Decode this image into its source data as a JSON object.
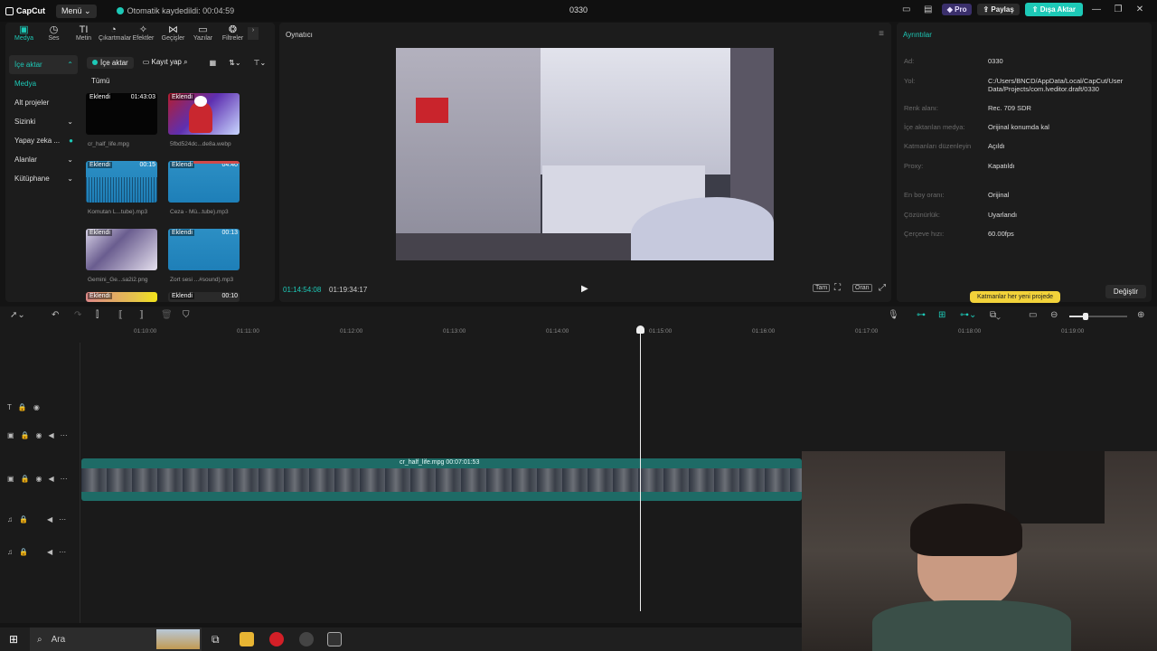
{
  "titlebar": {
    "app_name": "CapCut",
    "menu_label": "Menü",
    "autosave": "Otomatik kaydedildi: 00:04:59",
    "project_title": "0330",
    "pro_label": "Pro",
    "share_label": "Paylaş",
    "export_label": "Dışa Aktar"
  },
  "toolbar": {
    "tools": [
      {
        "label": "Medya",
        "icon": "media-icon"
      },
      {
        "label": "Ses",
        "icon": "audio-icon"
      },
      {
        "label": "Metin",
        "icon": "text-icon"
      },
      {
        "label": "Çıkartmalar",
        "icon": "sticker-icon"
      },
      {
        "label": "Efektler",
        "icon": "effects-icon"
      },
      {
        "label": "Geçişler",
        "icon": "transitions-icon"
      },
      {
        "label": "Yazılar",
        "icon": "captions-icon"
      },
      {
        "label": "Filtreler",
        "icon": "filters-icon"
      }
    ]
  },
  "sidebar": {
    "items": [
      {
        "label": "İçe aktar"
      },
      {
        "label": "Medya"
      },
      {
        "label": "Alt projeler"
      },
      {
        "label": "Sizinki"
      },
      {
        "label": "Yapay zeka ..."
      },
      {
        "label": "Alanlar"
      },
      {
        "label": "Kütüphane"
      }
    ]
  },
  "media": {
    "import_label": "İçe aktar",
    "record_label": "Kayıt yap",
    "all_label": "Tümü",
    "items": [
      {
        "tag": "Eklendi",
        "duration": "01:43:03",
        "name": "cr_half_life.mpg"
      },
      {
        "tag": "Eklendi",
        "duration": "",
        "name": "5fbd524dc...de8a.webp"
      },
      {
        "tag": "Eklendi",
        "duration": "00:15",
        "name": "Komutan L...tube).mp3"
      },
      {
        "tag": "Eklendi",
        "duration": "04:40",
        "name": "Ceza - Mü...tube).mp3"
      },
      {
        "tag": "Eklendi",
        "duration": "",
        "name": "Gemini_Ge...sa2i2.png"
      },
      {
        "tag": "Eklendi",
        "duration": "00:13",
        "name": "Zort sesi ...#sound).mp3"
      },
      {
        "tag": "Eklendi",
        "duration": "",
        "name": ""
      },
      {
        "tag": "Eklendi",
        "duration": "00:10",
        "name": ""
      }
    ]
  },
  "player": {
    "title": "Oynatıcı",
    "current_time": "01:14:54:08",
    "total_time": "01:19:34:17",
    "full_label": "Tam",
    "ratio_label": "Oran"
  },
  "details": {
    "title": "Ayrıntılar",
    "rows": [
      {
        "key": "Ad:",
        "value": "0330"
      },
      {
        "key": "Yol:",
        "value": "C:/Users/BNCD/AppData/Local/CapCut/User Data/Projects/com.lveditor.draft/0330"
      },
      {
        "key": "Renk alanı:",
        "value": "Rec. 709 SDR"
      },
      {
        "key": "İçe aktarılan medya:",
        "value": "Orijinal konumda kal"
      },
      {
        "key": "Katmanları düzenleyin",
        "value": "Açıldı"
      },
      {
        "key": "Proxy:",
        "value": "Kapatıldı"
      },
      {
        "key": "En boy oranı:",
        "value": "Orijinal"
      },
      {
        "key": "Çözünürlük:",
        "value": "Uyarlandı"
      },
      {
        "key": "Çerçeve hızı:",
        "value": "60.00fps"
      }
    ],
    "tooltip": "Katmanlar her yeni projede",
    "change_label": "Değiştir"
  },
  "timeline": {
    "ticks": [
      "01:10:00",
      "01:11:00",
      "01:12:00",
      "01:13:00",
      "01:14:00",
      "01:15:00",
      "01:16:00",
      "01:17:00",
      "01:18:00",
      "01:19:00"
    ],
    "clip_label": "cr_half_life.mpg  00:07:01:53"
  },
  "taskbar": {
    "search_placeholder": "Ara"
  },
  "colors": {
    "accent": "#1dc9b7",
    "clip": "#1e6b66",
    "tooltip": "#f2d23a"
  }
}
